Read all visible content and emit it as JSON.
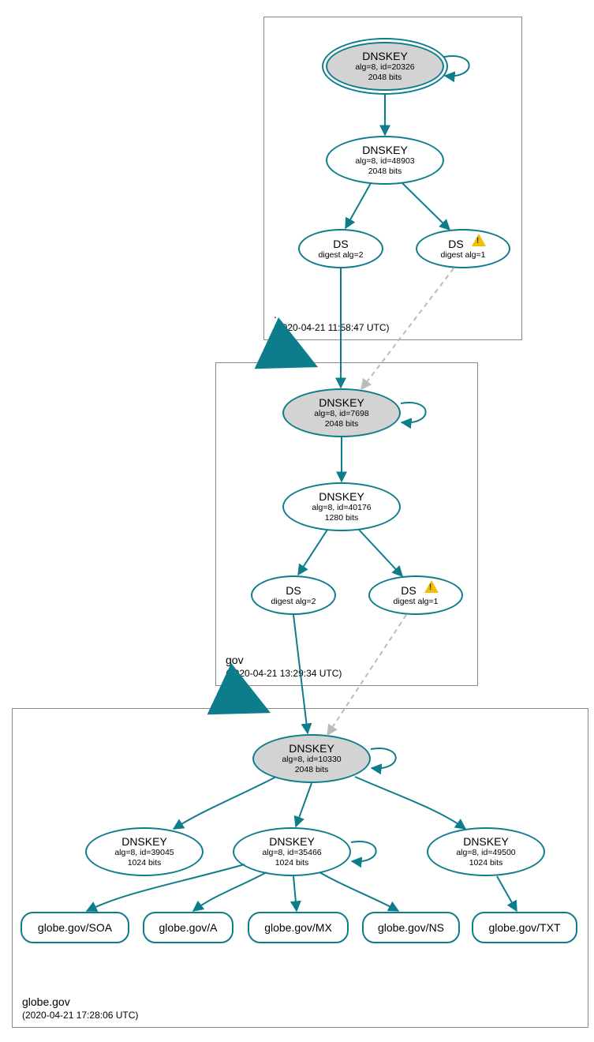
{
  "zones": {
    "root": {
      "label": ".",
      "timestamp": "(2020-04-21 11:58:47 UTC)",
      "nodes": {
        "k1": {
          "title": "DNSKEY",
          "line1": "alg=8, id=20326",
          "line2": "2048 bits"
        },
        "k2": {
          "title": "DNSKEY",
          "line1": "alg=8, id=48903",
          "line2": "2048 bits"
        },
        "ds1": {
          "title": "DS",
          "line1": "digest alg=2"
        },
        "ds2": {
          "title": "DS",
          "line1": "digest alg=1",
          "warn": true
        }
      }
    },
    "gov": {
      "label": "gov",
      "timestamp": "(2020-04-21 13:29:34 UTC)",
      "nodes": {
        "k1": {
          "title": "DNSKEY",
          "line1": "alg=8, id=7698",
          "line2": "2048 bits"
        },
        "k2": {
          "title": "DNSKEY",
          "line1": "alg=8, id=40176",
          "line2": "1280 bits"
        },
        "ds1": {
          "title": "DS",
          "line1": "digest alg=2"
        },
        "ds2": {
          "title": "DS",
          "line1": "digest alg=1",
          "warn": true
        }
      }
    },
    "globe": {
      "label": "globe.gov",
      "timestamp": "(2020-04-21 17:28:06 UTC)",
      "nodes": {
        "k1": {
          "title": "DNSKEY",
          "line1": "alg=8, id=10330",
          "line2": "2048 bits"
        },
        "k2": {
          "title": "DNSKEY",
          "line1": "alg=8, id=39045",
          "line2": "1024 bits"
        },
        "k3": {
          "title": "DNSKEY",
          "line1": "alg=8, id=35466",
          "line2": "1024 bits"
        },
        "k4": {
          "title": "DNSKEY",
          "line1": "alg=8, id=49500",
          "line2": "1024 bits"
        },
        "rr_soa": {
          "label": "globe.gov/SOA"
        },
        "rr_a": {
          "label": "globe.gov/A"
        },
        "rr_mx": {
          "label": "globe.gov/MX"
        },
        "rr_ns": {
          "label": "globe.gov/NS"
        },
        "rr_txt": {
          "label": "globe.gov/TXT"
        }
      }
    }
  }
}
